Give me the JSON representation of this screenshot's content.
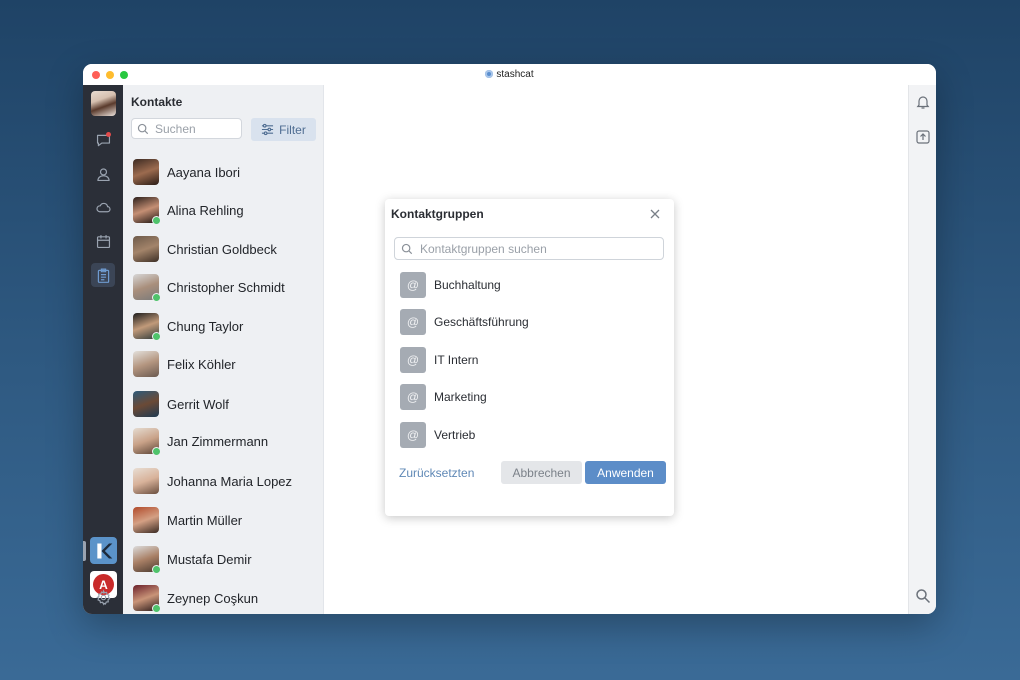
{
  "window": {
    "app_title": "stashcat"
  },
  "rail": {
    "icons": [
      "chat-bubble-icon",
      "person-icon",
      "cloud-icon",
      "calendar-icon",
      "clipboard-icon"
    ],
    "workspaces": [
      "k-workspace-logo",
      "a-workspace-logo"
    ],
    "workspace_a_letter": "A"
  },
  "contacts": {
    "title": "Kontakte",
    "search_placeholder": "Suchen",
    "filter_label": "Filter",
    "items": [
      {
        "name": "Aayana Ibori",
        "online": false
      },
      {
        "name": "Alina Rehling",
        "online": true
      },
      {
        "name": "Christian Goldbeck",
        "online": false
      },
      {
        "name": "Christopher Schmidt",
        "online": true
      },
      {
        "name": "Chung Taylor",
        "online": true
      },
      {
        "name": "Felix Köhler",
        "online": false
      },
      {
        "name": "Gerrit Wolf",
        "online": false
      },
      {
        "name": "Jan Zimmermann",
        "online": true
      },
      {
        "name": "Johanna Maria Lopez",
        "online": false
      },
      {
        "name": "Martin Müller",
        "online": false
      },
      {
        "name": "Mustafa Demir",
        "online": true
      },
      {
        "name": "Zeynep Coşkun",
        "online": true
      }
    ]
  },
  "dialog": {
    "title": "Kontaktgruppen",
    "search_placeholder": "Kontaktgruppen suchen",
    "group_icon_symbol": "@",
    "groups": [
      "Buchhaltung",
      "Geschäftsführung",
      "IT Intern",
      "Marketing",
      "Vertrieb"
    ],
    "reset_label": "Zurücksetzten",
    "cancel_label": "Abbrechen",
    "apply_label": "Anwenden"
  },
  "colors": {
    "accent": "#5c8dc8",
    "rail_bg": "#2b2f38",
    "online": "#4fc36b",
    "notification": "#e24b4b"
  }
}
